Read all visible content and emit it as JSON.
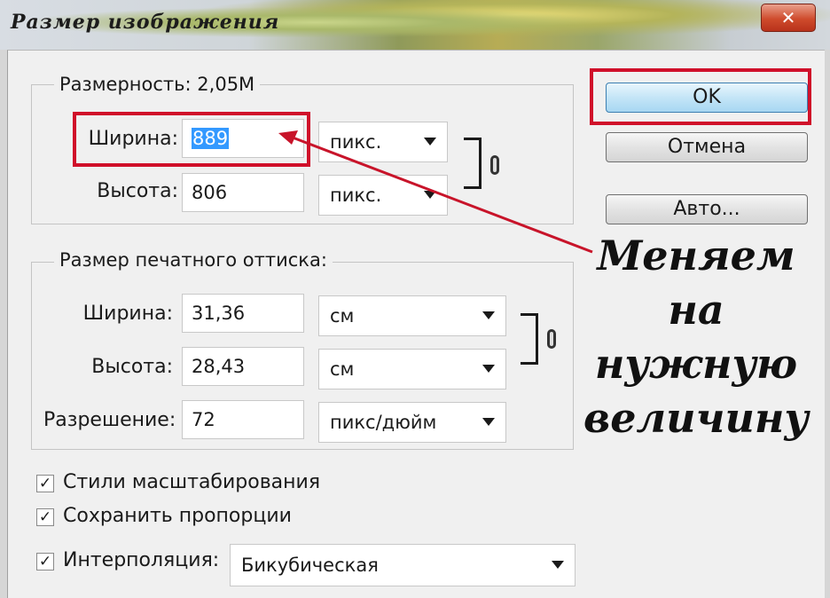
{
  "window": {
    "title": "Размер изображения",
    "close_symbol": "✕"
  },
  "pixel_dimensions": {
    "label": "Размерность:",
    "value": "2,05М",
    "width": {
      "label": "Ширина:",
      "value": "889",
      "unit": "пикс."
    },
    "height": {
      "label": "Высота:",
      "value": "806",
      "unit": "пикс."
    }
  },
  "document_size": {
    "label": "Размер печатного оттиска:",
    "width": {
      "label": "Ширина:",
      "value": "31,36",
      "unit": "см"
    },
    "height": {
      "label": "Высота:",
      "value": "28,43",
      "unit": "см"
    },
    "resolution": {
      "label": "Разрешение:",
      "value": "72",
      "unit": "пикс/дюйм"
    }
  },
  "buttons": {
    "ok": "OK",
    "cancel": "Отмена",
    "auto": "Авто..."
  },
  "options": {
    "scale_styles": {
      "label": "Стили масштабирования",
      "checked": true
    },
    "constrain": {
      "label": "Сохранить пропорции",
      "checked": true
    },
    "resample": {
      "label": "Интерполяция:",
      "checked": true,
      "value": "Бикубическая"
    }
  },
  "annotation": {
    "lines": [
      "Меняем",
      "на",
      "нужную",
      "величину"
    ]
  },
  "colors": {
    "highlight_box": "#d0102a",
    "arrow": "#c8142a",
    "selection": "#3399ff"
  },
  "icons": [
    "close-icon",
    "chain-link-icon",
    "dropdown-arrow-icon",
    "checkbox-check-icon",
    "red-arrow"
  ]
}
